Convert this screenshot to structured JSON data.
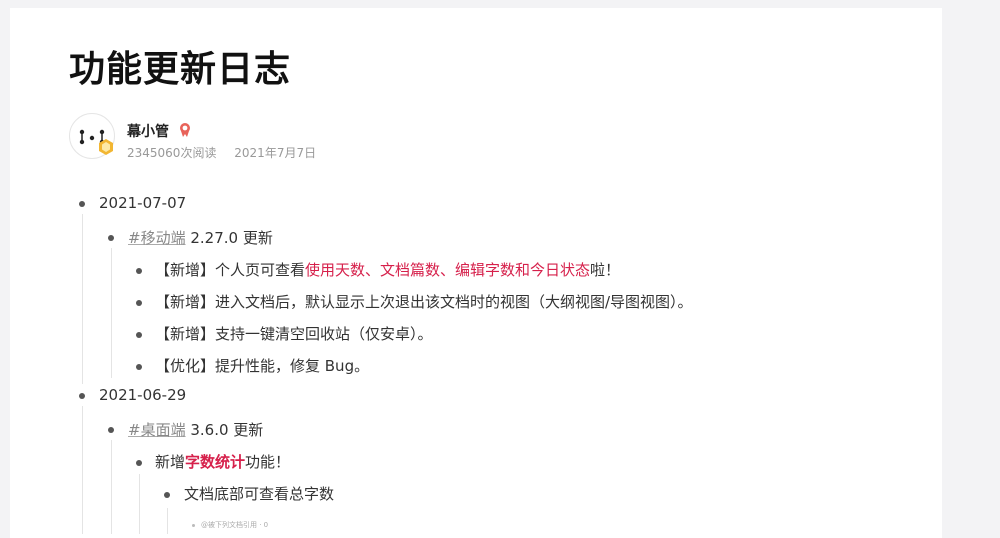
{
  "page": {
    "title": "功能更新日志",
    "author": {
      "name": "幕小管",
      "views": "2345060次阅读",
      "date": "2021年7月7日"
    }
  },
  "log": {
    "d1": "2021-07-07",
    "d1_group": {
      "tag": "#移动端",
      "suffix": " 2.27.0 更新"
    },
    "d1_items": [
      {
        "prefix": "【新增】个人页可查看",
        "highlight": "使用天数、文档篇数、编辑字数和今日状态",
        "suffix": "啦！"
      },
      {
        "text": "【新增】进入文档后，默认显示上次退出该文档时的视图（大纲视图/导图视图）。"
      },
      {
        "text": "【新增】支持一键清空回收站（仅安卓）。"
      },
      {
        "text": "【优化】提升性能，修复 Bug。"
      }
    ],
    "d2": "2021-06-29",
    "d2_group": {
      "tag": "#桌面端",
      "suffix": " 3.6.0 更新"
    },
    "d2_item": {
      "prefix": "新增",
      "highlight": "字数统计",
      "suffix": "功能！"
    },
    "d2_sub": "文档底部可查看总字数",
    "d2_subsub": "@被下列文档引用 · 0"
  },
  "colors": {
    "highlight": "#d6204b",
    "muted": "#999999"
  }
}
